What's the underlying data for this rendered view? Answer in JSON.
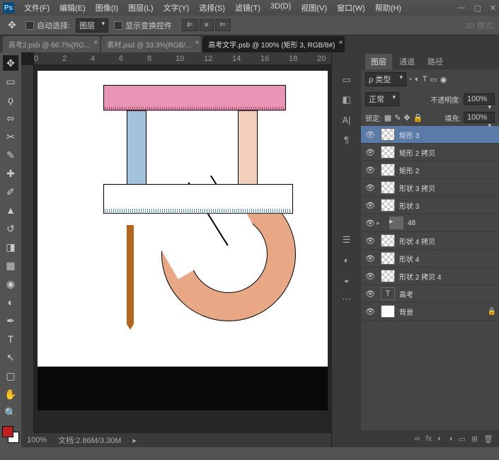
{
  "app": {
    "logo": "Ps"
  },
  "menu": [
    "文件(F)",
    "编辑(E)",
    "图像(I)",
    "图层(L)",
    "文字(Y)",
    "选择(S)",
    "滤镜(T)",
    "3D(D)",
    "视图(V)",
    "窗口(W)",
    "帮助(H)"
  ],
  "winctrl": {
    "min": "—",
    "max": "▢",
    "close": "✕"
  },
  "options": {
    "autoselect_lbl": "自动选择:",
    "autoselect_val": "图层",
    "showtransform": "显示变换控件",
    "mode3d_lbl": "3D 模式:"
  },
  "tabs": [
    {
      "label": "高考2.psb @ 66.7%(RG...",
      "active": false
    },
    {
      "label": "素材.psd @ 33.3%(RGB/...",
      "active": false
    },
    {
      "label": "高考文字.psb @ 100% (矩形 3, RGB/8#)",
      "active": true
    }
  ],
  "ruler_marks": [
    "0",
    "2",
    "4",
    "6",
    "8",
    "10",
    "12",
    "14",
    "16",
    "18",
    "20"
  ],
  "status": {
    "zoom": "100%",
    "doc": "文档:2.86M/3.30M"
  },
  "panels": {
    "tabs": [
      "图层",
      "通道",
      "路径"
    ],
    "kind": "ρ 类型",
    "mode": "正常",
    "opacity_lbl": "不透明度:",
    "opacity_val": "100%",
    "lock_lbl": "锁定:",
    "fill_lbl": "填充:",
    "fill_val": "100%"
  },
  "layers": [
    {
      "name": "矩形 3",
      "sel": true,
      "thumb": "ck"
    },
    {
      "name": "矩形 2 拷贝",
      "thumb": "ck"
    },
    {
      "name": "矩形 2",
      "thumb": "ck"
    },
    {
      "name": "形状 3 拷贝",
      "thumb": "ck"
    },
    {
      "name": "形状 3",
      "thumb": "ck"
    },
    {
      "name": "48",
      "folder": true
    },
    {
      "name": "形状 4 拷贝",
      "thumb": "ck"
    },
    {
      "name": "形状 4",
      "thumb": "ck"
    },
    {
      "name": "形状 2 拷贝 4",
      "thumb": "ck"
    },
    {
      "name": "高考",
      "txt": true
    },
    {
      "name": "背景",
      "thumb": "white",
      "locked": true
    }
  ],
  "footer_icons": [
    "∞",
    "fx",
    "◐",
    "◑",
    "▭",
    "⊞",
    "🗑"
  ]
}
